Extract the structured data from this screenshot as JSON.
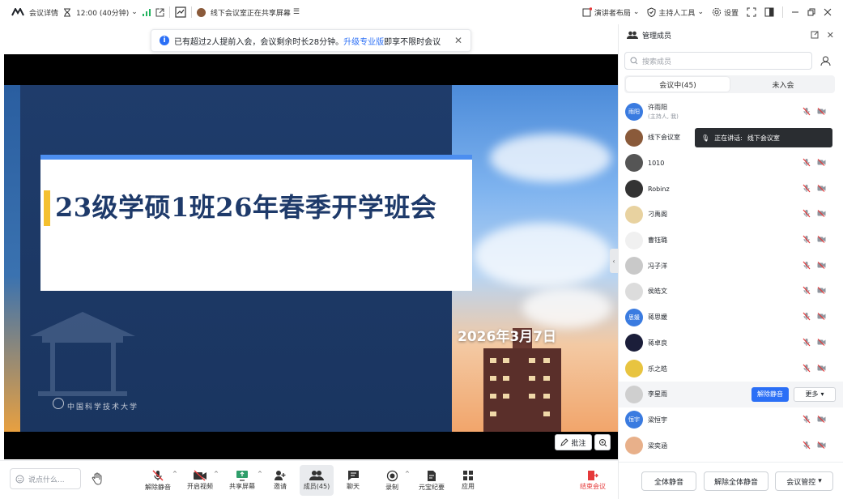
{
  "topbar": {
    "meeting_info": "会议详情",
    "duration": "12:00 (40分钟)",
    "sharing_status": "线下会议室正在共享屏幕",
    "speaker_layout": "演讲者布局",
    "host_tools": "主持人工具",
    "settings": "设置"
  },
  "notice": {
    "text_before": "已有超过2人提前入会，会议剩余时长28分钟。",
    "link": "升级专业版",
    "text_after": "即享不限时会议"
  },
  "slide": {
    "title": "23级学硕1班26年春季开学班会",
    "date": "2026年3月7日",
    "university_logo_text": "中国科学技术大学"
  },
  "stage_controls": {
    "annotate": "批注"
  },
  "toolbar": {
    "say_placeholder": "说点什么...",
    "unmute": "解除静音",
    "video": "开启视频",
    "share": "共享屏幕",
    "invite": "邀请",
    "members": "成员(45)",
    "chat": "聊天",
    "record": "录制",
    "ai_minutes": "元宝纪要",
    "apps": "应用",
    "end": "结束会议"
  },
  "panel": {
    "title": "管理成员",
    "search_placeholder": "搜索成员",
    "tab_in_meeting": "会议中(45)",
    "tab_not_joined": "未入会",
    "speaking_label": "正在讲话:",
    "speaking_name": "线下会议室",
    "unmute_button": "解除静音",
    "more_button": "更多",
    "members": [
      {
        "name": "许雨阳",
        "sub": "(主持人, 我)",
        "avatar_text": "雨阳",
        "color": "#3a7be0"
      },
      {
        "name": "线下会议室",
        "sub": "",
        "avatar_text": "",
        "color": "#8a5a3a"
      },
      {
        "name": "1010",
        "sub": "",
        "avatar_text": "",
        "color": "#555555"
      },
      {
        "name": "Robinz",
        "sub": "",
        "avatar_text": "",
        "color": "#333333"
      },
      {
        "name": "刁禹阁",
        "sub": "",
        "avatar_text": "",
        "color": "#e8d2a0"
      },
      {
        "name": "曹钰璐",
        "sub": "",
        "avatar_text": "",
        "color": "#f0f0f0"
      },
      {
        "name": "冯子洋",
        "sub": "",
        "avatar_text": "",
        "color": "#c9c9c9"
      },
      {
        "name": "侯皓文",
        "sub": "",
        "avatar_text": "",
        "color": "#dcdcdc"
      },
      {
        "name": "蒋思媛",
        "sub": "",
        "avatar_text": "思媛",
        "color": "#3a7be0"
      },
      {
        "name": "蒋卓良",
        "sub": "",
        "avatar_text": "",
        "color": "#1b1e3a"
      },
      {
        "name": "乐之皓",
        "sub": "",
        "avatar_text": "",
        "color": "#e8c440"
      },
      {
        "name": "李星雨",
        "sub": "",
        "avatar_text": "",
        "color": "#cfcfcf"
      },
      {
        "name": "梁恒宇",
        "sub": "",
        "avatar_text": "恒宇",
        "color": "#3a7be0"
      },
      {
        "name": "梁奕涵",
        "sub": "",
        "avatar_text": "",
        "color": "#e8b08a"
      }
    ],
    "footer": {
      "mute_all": "全体静音",
      "unmute_all": "解除全体静音",
      "meeting_control": "会议管控"
    }
  }
}
